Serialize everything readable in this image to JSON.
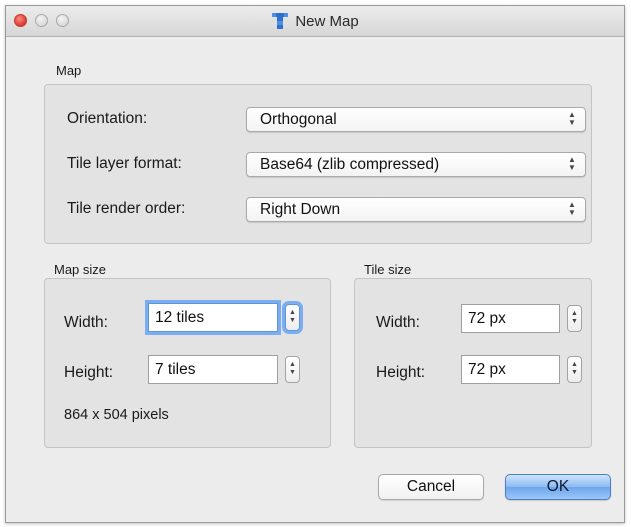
{
  "window": {
    "title": "New Map"
  },
  "map_group": {
    "title": "Map",
    "orientation_label": "Orientation:",
    "orientation_value": "Orthogonal",
    "layer_format_label": "Tile layer format:",
    "layer_format_value": "Base64 (zlib compressed)",
    "render_order_label": "Tile render order:",
    "render_order_value": "Right Down"
  },
  "map_size": {
    "title": "Map size",
    "width_label": "Width:",
    "width_value": "12 tiles",
    "height_label": "Height:",
    "height_value": "7 tiles",
    "pixels_text": "864 x 504 pixels"
  },
  "tile_size": {
    "title": "Tile size",
    "width_label": "Width:",
    "width_value": "72 px",
    "height_label": "Height:",
    "height_value": "72 px"
  },
  "buttons": {
    "cancel": "Cancel",
    "ok": "OK"
  },
  "icons": {
    "app": "tiled-app-icon",
    "select_arrows": "up-down-arrows-icon",
    "stepper": "stepper-arrows-icon"
  },
  "colors": {
    "accent": "#7aaef1",
    "default_button": "#6ea6ee",
    "close_button": "#e0443e"
  }
}
